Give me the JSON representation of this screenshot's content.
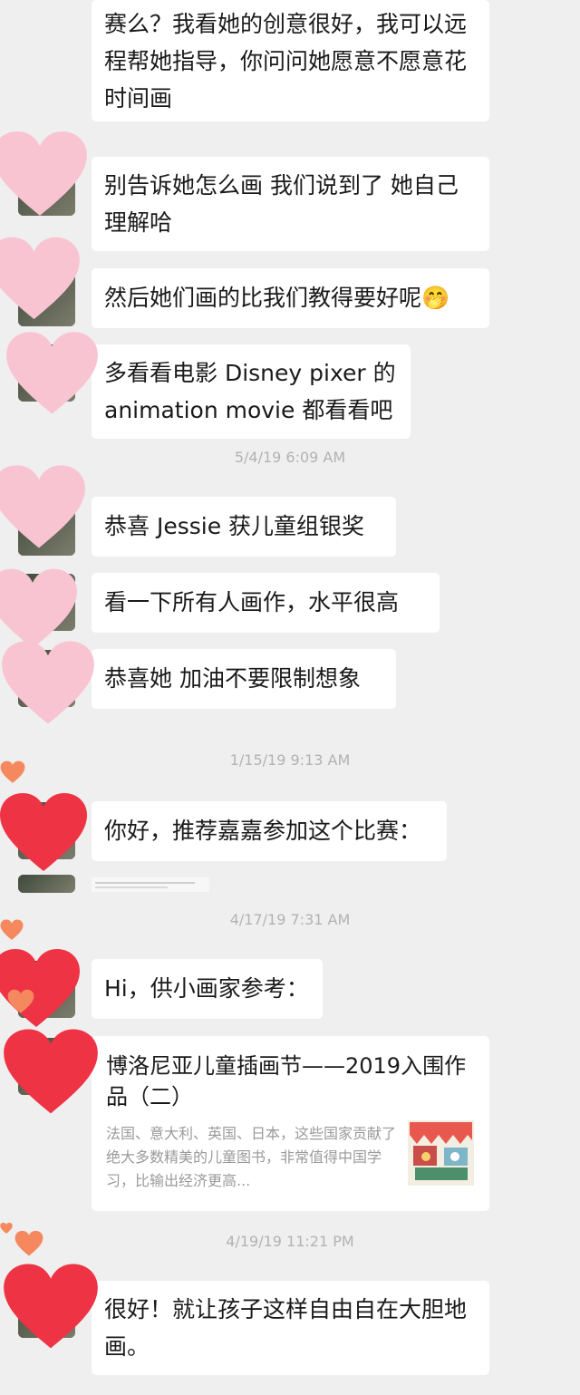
{
  "messages": [
    {
      "text": "赛么？我看她的创意很好，我可以远程帮她指导，你问问她愿意不愿意花时间画"
    },
    {
      "text": "别告诉她怎么画 我们说到了 她自己理解哈"
    },
    {
      "text": "然后她们画的比我们教得要好呢🤭"
    },
    {
      "text": "多看看电影 Disney pixer 的 animation movie 都看看吧"
    },
    {
      "text": "恭喜 Jessie 获儿童组银奖"
    },
    {
      "text": "看一下所有人画作，水平很高"
    },
    {
      "text": "恭喜她 加油不要限制想象"
    },
    {
      "text": "你好，推荐嘉嘉参加这个比赛："
    },
    {
      "text": "Hi，供小画家参考："
    },
    {
      "text": "很好！就让孩子这样自由自在大胆地画。"
    }
  ],
  "timestamps": [
    "5/4/19 6:09 AM",
    "1/15/19 9:13 AM",
    "4/17/19 7:31 AM",
    "4/19/19 11:21 PM"
  ],
  "link_card": {
    "title": "博洛尼亚儿童插画节——2019入围作品（二）",
    "description": "法国、意大利、英国、日本，这些国家贡献了绝大多数精美的儿童图书，非常值得中国学习，比输出经济更高...",
    "thumbnail_icon": "illustration-thumbnail"
  },
  "colors": {
    "background": "#efefef",
    "bubble": "#ffffff",
    "timestamp": "#b2b2b2",
    "heart_pink": "#f9c4d2",
    "heart_red": "#ee3344",
    "heart_orange": "#f5885e"
  }
}
